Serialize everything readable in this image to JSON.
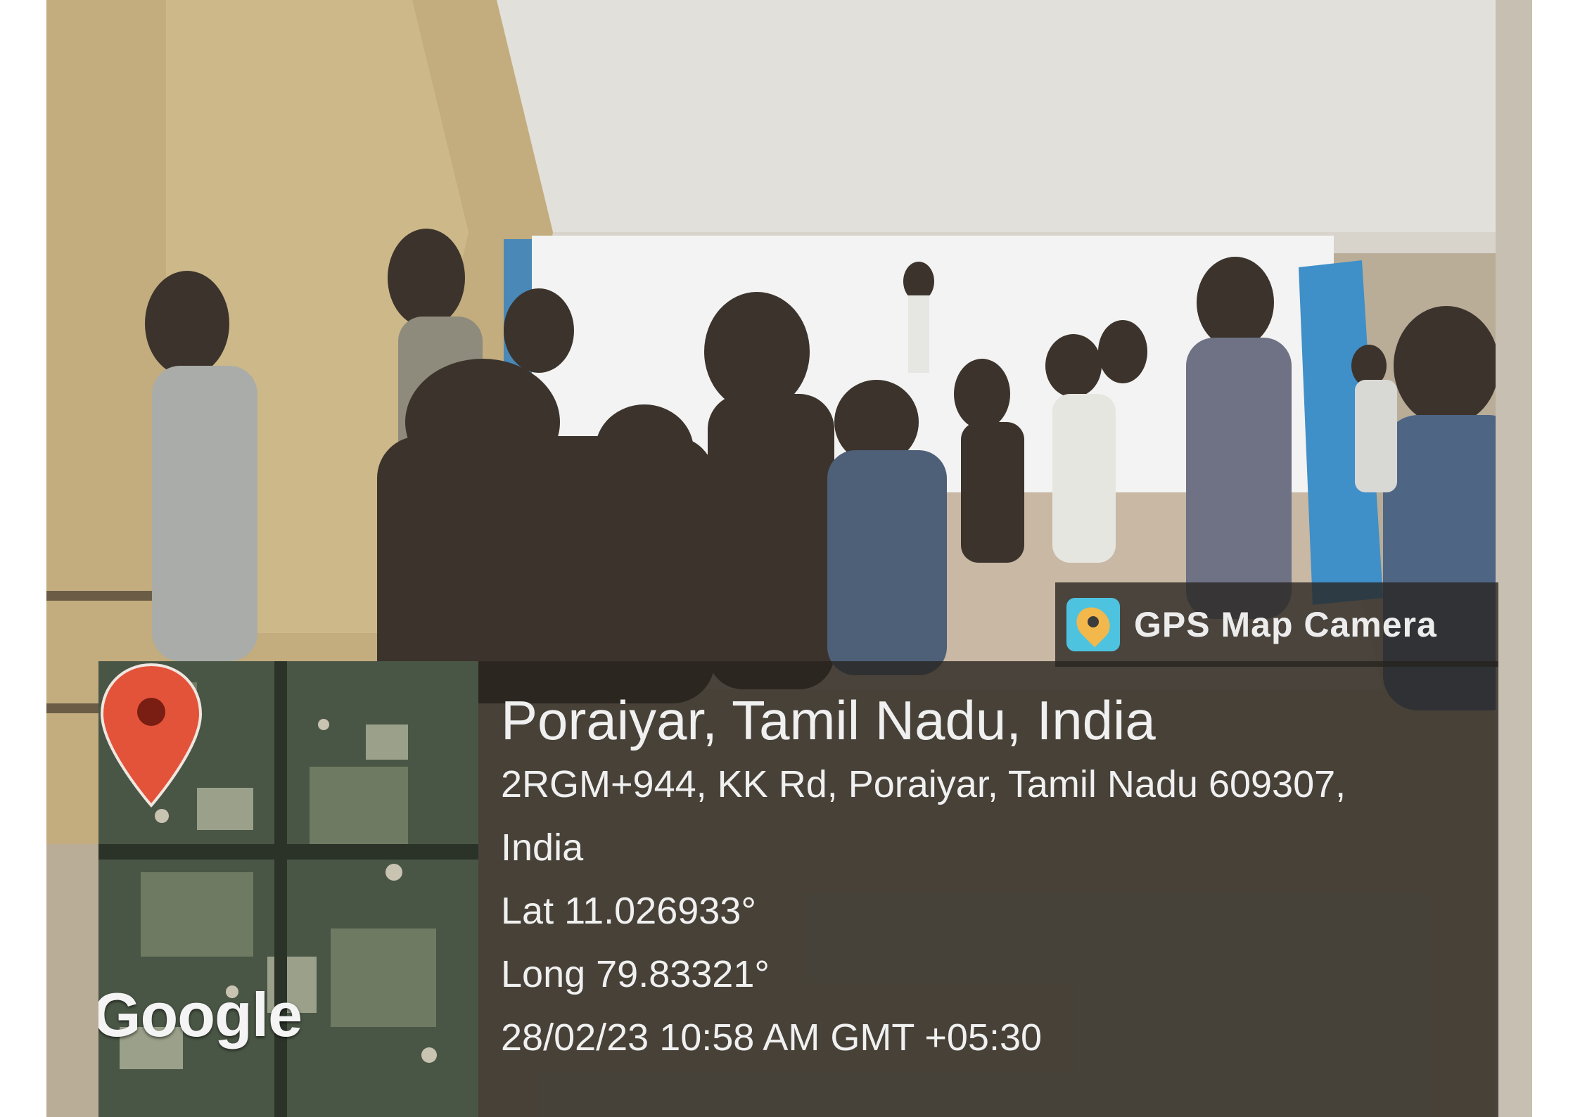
{
  "badge": {
    "app_name": "GPS Map Camera",
    "icon": "gps-map-camera-app-icon"
  },
  "map": {
    "brand": "Google",
    "pin_icon": "location-pin-icon",
    "pin_color": "#e2533a"
  },
  "location": {
    "place": "Poraiyar, Tamil Nadu, India",
    "address_line1": "2RGM+944, KK Rd, Poraiyar, Tamil Nadu 609307,",
    "address_line2": "India",
    "latitude": "Lat 11.026933°",
    "longitude": "Long 79.83321°",
    "timestamp": "28/02/23 10:58 AM GMT +05:30"
  }
}
